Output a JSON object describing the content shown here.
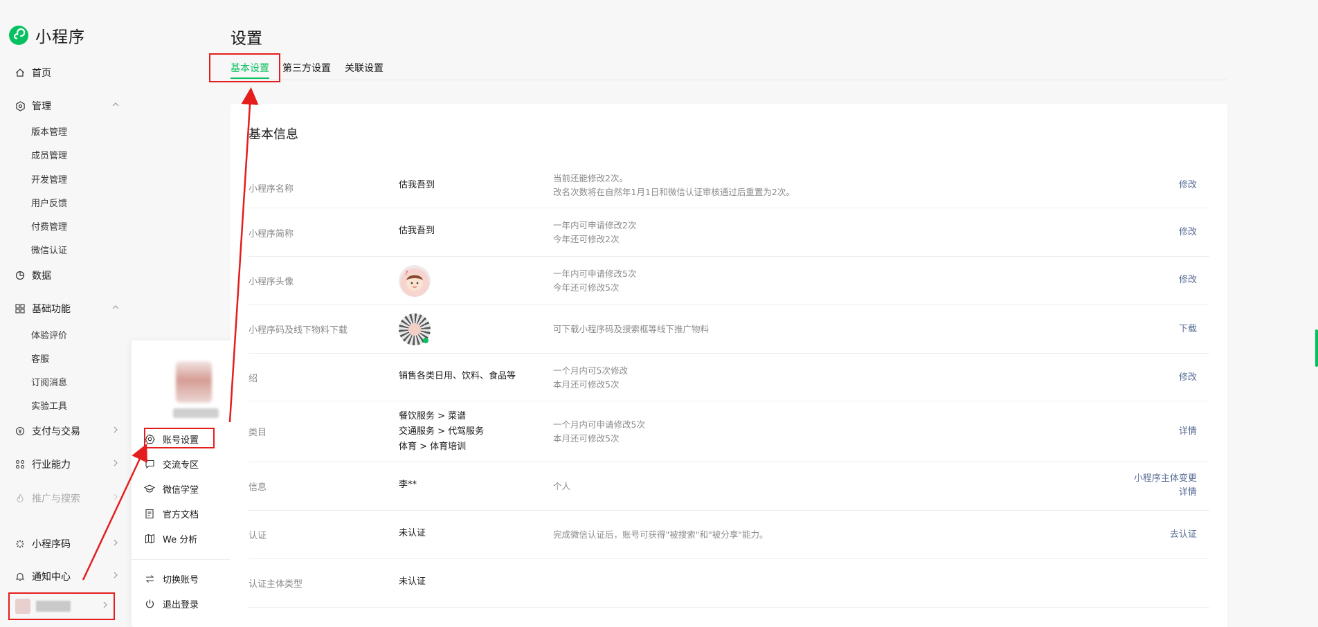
{
  "brand": {
    "title": "小程序"
  },
  "nav": {
    "home": "首页",
    "manage": "管理",
    "manage_items": [
      "版本管理",
      "成员管理",
      "开发管理",
      "用户反馈",
      "付费管理",
      "微信认证"
    ],
    "data": "数据",
    "basic": "基础功能",
    "basic_items": [
      "体验评价",
      "客服",
      "订阅消息",
      "实验工具"
    ],
    "pay": "支付与交易",
    "industry": "行业能力",
    "promotion": "推广与搜索",
    "mini_code": "小程序码",
    "notice": "通知中心"
  },
  "popup": {
    "items": [
      "账号设置",
      "交流专区",
      "微信学堂",
      "官方文档",
      "We 分析",
      "切换账号",
      "退出登录"
    ]
  },
  "main": {
    "title": "设置",
    "tabs": [
      "基本设置",
      "第三方设置",
      "关联设置"
    ],
    "card_title": "基本信息",
    "rows": [
      {
        "label": "小程序名称",
        "value": "估我吾到",
        "desc": [
          "当前还能修改2次。",
          "改名次数将在自然年1月1日和微信认证审核通过后重置为2次。"
        ],
        "action": [
          "修改"
        ]
      },
      {
        "label": "小程序简称",
        "value": "估我吾到",
        "desc": [
          "一年内可申请修改2次",
          "今年还可修改2次"
        ],
        "action": [
          "修改"
        ]
      },
      {
        "label": "小程序头像",
        "value": "",
        "desc": [
          "一年内可申请修改5次",
          "今年还可修改5次"
        ],
        "action": [
          "修改"
        ]
      },
      {
        "label": "小程序码及线下物料下载",
        "value": "",
        "desc": [
          "可下载小程序码及搜索框等线下推广物料"
        ],
        "action": [
          "下载"
        ]
      },
      {
        "label": "绍",
        "value": "销售各类日用、饮料、食品等",
        "desc": [
          "一个月内可5次修改",
          "本月还可修改5次"
        ],
        "action": [
          "修改"
        ]
      },
      {
        "label": "类目",
        "value": [
          "餐饮服务 > 菜谱",
          "交通服务 > 代驾服务",
          "体育 > 体育培训"
        ],
        "desc": [
          "一个月内可申请修改5次",
          "本月还可修改5次"
        ],
        "action": [
          "详情"
        ]
      },
      {
        "label": "信息",
        "value": "李**",
        "desc": [
          "个人"
        ],
        "action": [
          "小程序主体变更",
          "详情"
        ]
      },
      {
        "label": "认证",
        "value": "未认证",
        "desc": [
          "完成微信认证后，账号可获得\"被搜索\"和\"被分享\"能力。"
        ],
        "action": [
          "去认证"
        ]
      },
      {
        "label": "认证主体类型",
        "value": "未认证",
        "desc": [],
        "action": []
      }
    ]
  },
  "colors": {
    "accent": "#07c160",
    "link": "#576b95",
    "highlight": "#e41d1d"
  }
}
